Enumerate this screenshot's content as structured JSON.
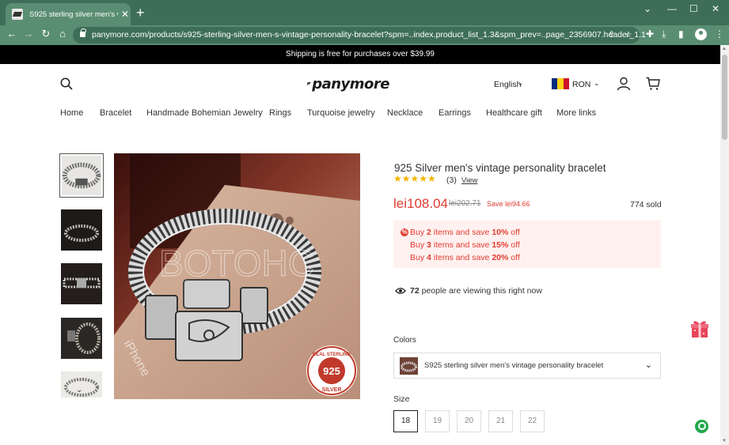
{
  "browser": {
    "tab_title": "S925 sterling silver men's vintage",
    "url": "panymore.com/products/s925-sterling-silver-men-s-vintage-personality-bracelet?spm=..index.product_list_1.3&spm_prev=..page_2356907.header_1.1"
  },
  "announcement": "Shipping is free for purchases over $39.99",
  "header": {
    "logo_text": "panymore",
    "language": "English",
    "currency": "RON",
    "flag_colors": [
      "#002b7f",
      "#fcd116",
      "#ce1126"
    ]
  },
  "nav": [
    "Home",
    "Bracelet",
    "Handmade Bohemian Jewelry",
    "Rings",
    "Turquoise jewelry",
    "Necklace",
    "Earrings",
    "Healthcare gift",
    "More links"
  ],
  "gallery": {
    "thumbnail_count": 5,
    "watermark": "BOTOHC",
    "badge": {
      "top": "REAL STERLING",
      "middle": "925",
      "bottom": "SILVER"
    },
    "engraving": "iPhone"
  },
  "product": {
    "title": "925 Silver men's vintage personality bracelet",
    "stars": "★★★★★",
    "rating": 5,
    "review_count": "(3)",
    "review_link": "View",
    "price": "lei108.04",
    "original_price": "lei202.71",
    "save": "Save lei94.66",
    "sold": "774 sold"
  },
  "promotions": [
    {
      "prefix": "Buy ",
      "qty": "2",
      "middle": " items and save ",
      "pct": "10%",
      "suffix": " off"
    },
    {
      "prefix": "Buy ",
      "qty": "3",
      "middle": " items and save ",
      "pct": "15%",
      "suffix": " off"
    },
    {
      "prefix": "Buy ",
      "qty": "4",
      "middle": " items and save ",
      "pct": "20%",
      "suffix": " off"
    }
  ],
  "viewers": {
    "count": "72",
    "text": " people are viewing this right now"
  },
  "colors": {
    "label": "Colors",
    "selected": "S925 sterling silver men's vintage personality bracelet"
  },
  "size": {
    "label": "Size",
    "options": [
      "18",
      "19",
      "20",
      "21",
      "22"
    ],
    "selected": "18"
  },
  "theme": {
    "accent": "#e03c31",
    "chrome": "#5a8e72",
    "stars": "#f4b400"
  }
}
